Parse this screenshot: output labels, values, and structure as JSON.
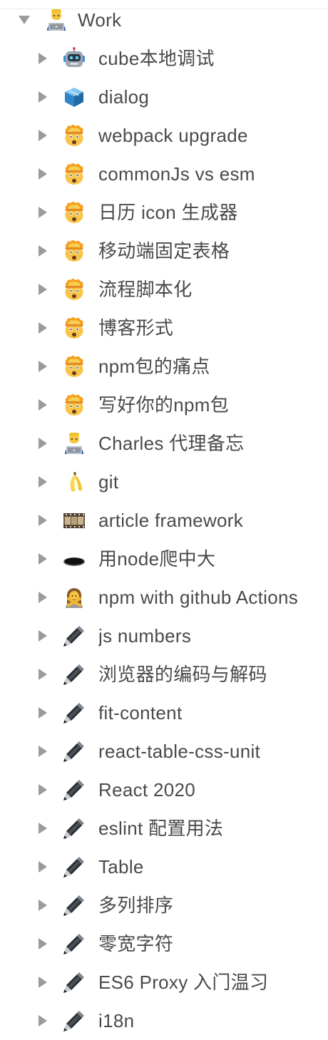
{
  "tree": {
    "root": {
      "label": "Work",
      "icon": "technologist-icon",
      "expanded": true
    },
    "items": [
      {
        "label": "cube本地调试",
        "icon": "robot-icon"
      },
      {
        "label": "dialog",
        "icon": "box-icon"
      },
      {
        "label": "webpack upgrade",
        "icon": "exploding-head-icon"
      },
      {
        "label": "commonJs vs esm",
        "icon": "exploding-head-icon"
      },
      {
        "label": "日历 icon 生成器",
        "icon": "exploding-head-icon"
      },
      {
        "label": "移动端固定表格",
        "icon": "exploding-head-icon"
      },
      {
        "label": "流程脚本化",
        "icon": "exploding-head-icon"
      },
      {
        "label": "博客形式",
        "icon": "exploding-head-icon"
      },
      {
        "label": "npm包的痛点",
        "icon": "exploding-head-icon"
      },
      {
        "label": "写好你的npm包",
        "icon": "exploding-head-icon"
      },
      {
        "label": "Charles 代理备忘",
        "icon": "technologist-icon"
      },
      {
        "label": "git",
        "icon": "banana-icon"
      },
      {
        "label": "article framework",
        "icon": "film-frames-icon"
      },
      {
        "label": "用node爬中大",
        "icon": "hole-icon"
      },
      {
        "label": "npm with github Actions",
        "icon": "gesturing-no-icon"
      },
      {
        "label": "js numbers",
        "icon": "pen-icon"
      },
      {
        "label": "浏览器的编码与解码",
        "icon": "pen-icon"
      },
      {
        "label": "fit-content",
        "icon": "pen-icon"
      },
      {
        "label": "react-table-css-unit",
        "icon": "pen-icon"
      },
      {
        "label": "React 2020",
        "icon": "pen-icon"
      },
      {
        "label": "eslint 配置用法",
        "icon": "pen-icon"
      },
      {
        "label": "Table",
        "icon": "pen-icon"
      },
      {
        "label": "多列排序",
        "icon": "pen-icon"
      },
      {
        "label": "零宽字符",
        "icon": "pen-icon"
      },
      {
        "label": "ES6 Proxy 入门温习",
        "icon": "pen-icon"
      },
      {
        "label": "i18n",
        "icon": "pen-icon"
      }
    ]
  }
}
